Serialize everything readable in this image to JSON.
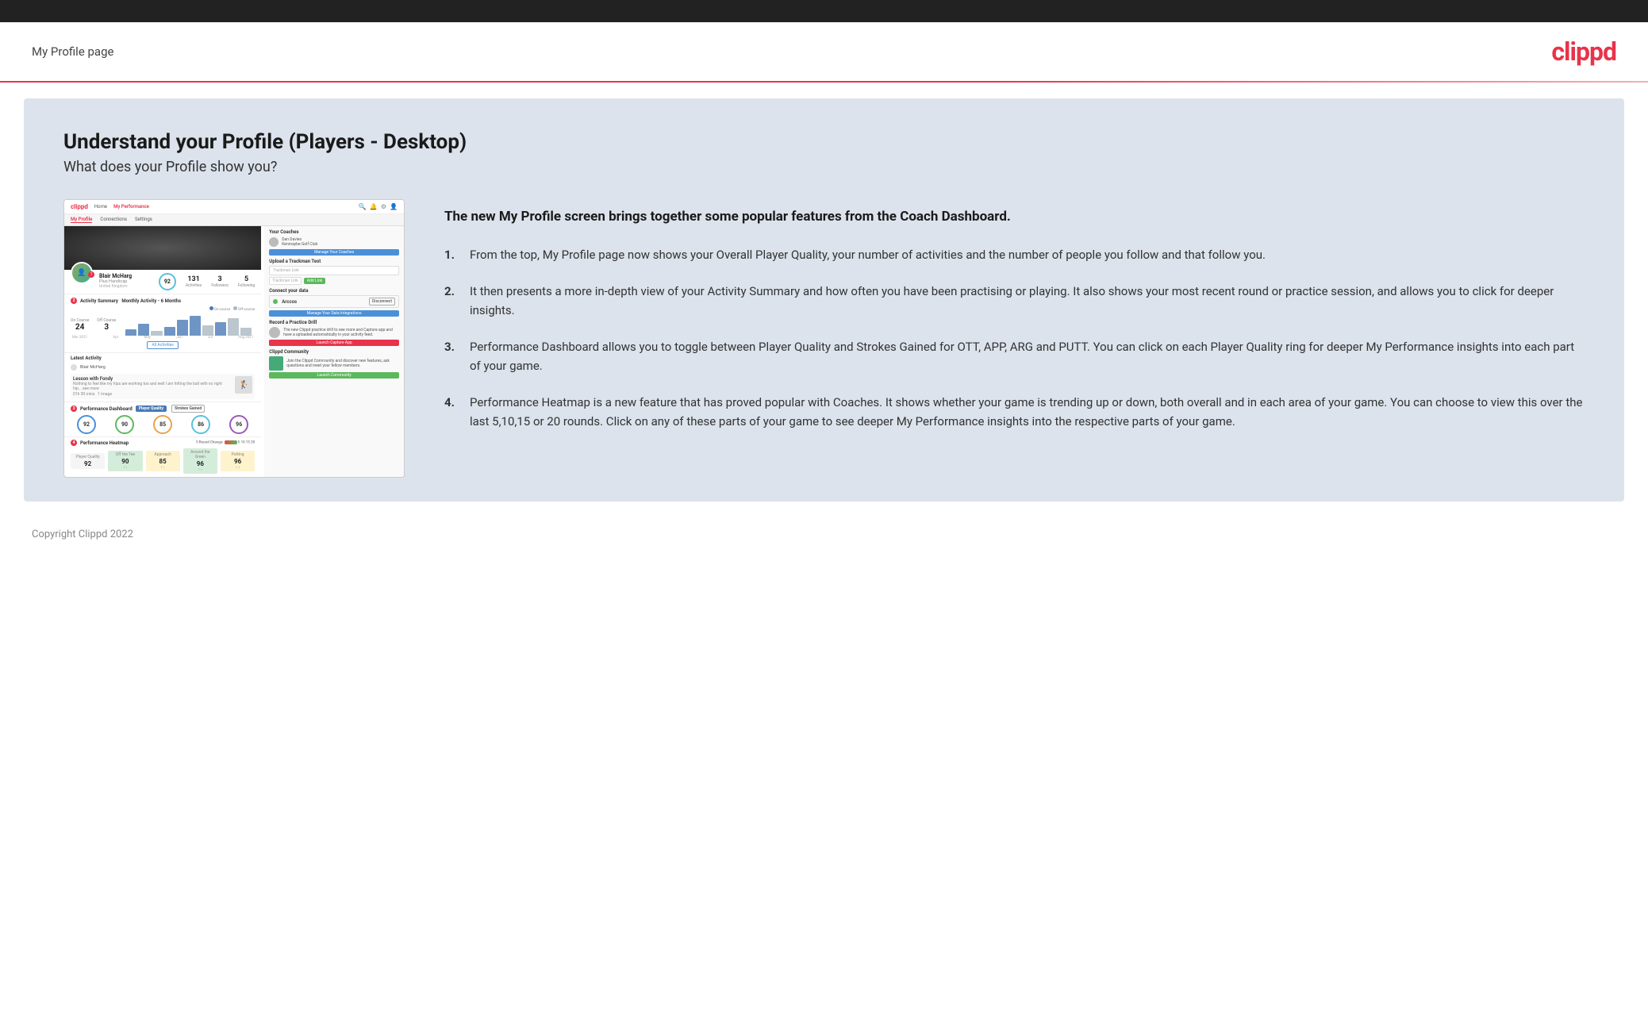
{
  "header": {
    "title": "My Profile page",
    "logo": "clippd"
  },
  "main": {
    "heading": "Understand your Profile (Players - Desktop)",
    "subheading": "What does your Profile show you?",
    "intro_bold": "The new My Profile screen brings together some popular features from the Coach Dashboard.",
    "list_items": [
      {
        "num": "1.",
        "text": "From the top, My Profile page now shows your Overall Player Quality, your number of activities and the number of people you follow and that follow you."
      },
      {
        "num": "2.",
        "text": "It then presents a more in-depth view of your Activity Summary and how often you have been practising or playing. It also shows your most recent round or practice session, and allows you to click for deeper insights."
      },
      {
        "num": "3.",
        "text": "Performance Dashboard allows you to toggle between Player Quality and Strokes Gained for OTT, APP, ARG and PUTT. You can click on each Player Quality ring for deeper My Performance insights into each part of your game."
      },
      {
        "num": "4.",
        "text": "Performance Heatmap is a new feature that has proved popular with Coaches. It shows whether your game is trending up or down, both overall and in each area of your game. You can choose to view this over the last 5,10,15 or 20 rounds. Click on any of these parts of your game to see deeper My Performance insights into the respective parts of your game."
      }
    ]
  },
  "mockup": {
    "nav": {
      "logo": "clippd",
      "items": [
        "Home",
        "My Performance"
      ],
      "active": "My Profile"
    },
    "subnav": [
      "My Profile",
      "Connections",
      "Settings"
    ],
    "subnav_active": "My Profile",
    "profile": {
      "name": "Blair McHarg",
      "handicap": "Plus Handicap",
      "location": "United Kingdom",
      "quality": "92",
      "activities": "131",
      "followers": "3",
      "following": "5"
    },
    "activity": {
      "title": "Activity Summary",
      "on_course": "24",
      "off_course": "3",
      "bars": [
        8,
        14,
        6,
        10,
        18,
        22,
        12,
        16,
        20,
        9
      ]
    },
    "perf_dashboard": {
      "title": "Performance Dashboard",
      "rings": [
        {
          "val": "92",
          "cls": "ring-blue"
        },
        {
          "val": "90",
          "cls": "ring-green"
        },
        {
          "val": "85",
          "cls": "ring-orange"
        },
        {
          "val": "86",
          "cls": "ring-teal"
        },
        {
          "val": "96",
          "cls": "ring-purple"
        }
      ]
    },
    "heatmap": {
      "title": "Performance Heatmap",
      "cells": [
        {
          "label": "Player Quality",
          "val": "92",
          "change": "",
          "cls": "hm-plain"
        },
        {
          "label": "Off the Tee",
          "val": "90",
          "change": "↑↓",
          "cls": "hm-green"
        },
        {
          "label": "Approach",
          "val": "85",
          "change": "↑↓",
          "cls": "hm-yellow"
        },
        {
          "label": "Around the Green",
          "val": "96",
          "change": "↑↓",
          "cls": "hm-green"
        },
        {
          "label": "Putting",
          "val": "96",
          "change": "↑↓",
          "cls": "hm-yellow"
        }
      ]
    },
    "coaches": {
      "title": "Your Coaches",
      "name": "Dan Davies",
      "club": "Kenmaybe Golf Club",
      "btn": "Manage Your Coaches"
    },
    "trackman": {
      "title": "Upload a Trackman Test",
      "placeholder": "Trackman Link",
      "btn": "Add Link"
    },
    "connect": {
      "title": "Connect your data",
      "provider": "Arccos",
      "btn": "Disconnect",
      "manage_btn": "Manage Your Data Integrations"
    },
    "drill": {
      "title": "Record a Practice Drill",
      "desc": "The new Clippd practice drill to see more and Capture app and have a uploaded automatically in your activity feed.",
      "btn": "Launch Capture App"
    },
    "community": {
      "title": "Clippd Community",
      "desc": "Join the Clippd Community and discover new features, ask questions and meet your fellow members.",
      "btn": "Launch Community"
    }
  },
  "footer": {
    "copyright": "Copyright Clippd 2022"
  }
}
